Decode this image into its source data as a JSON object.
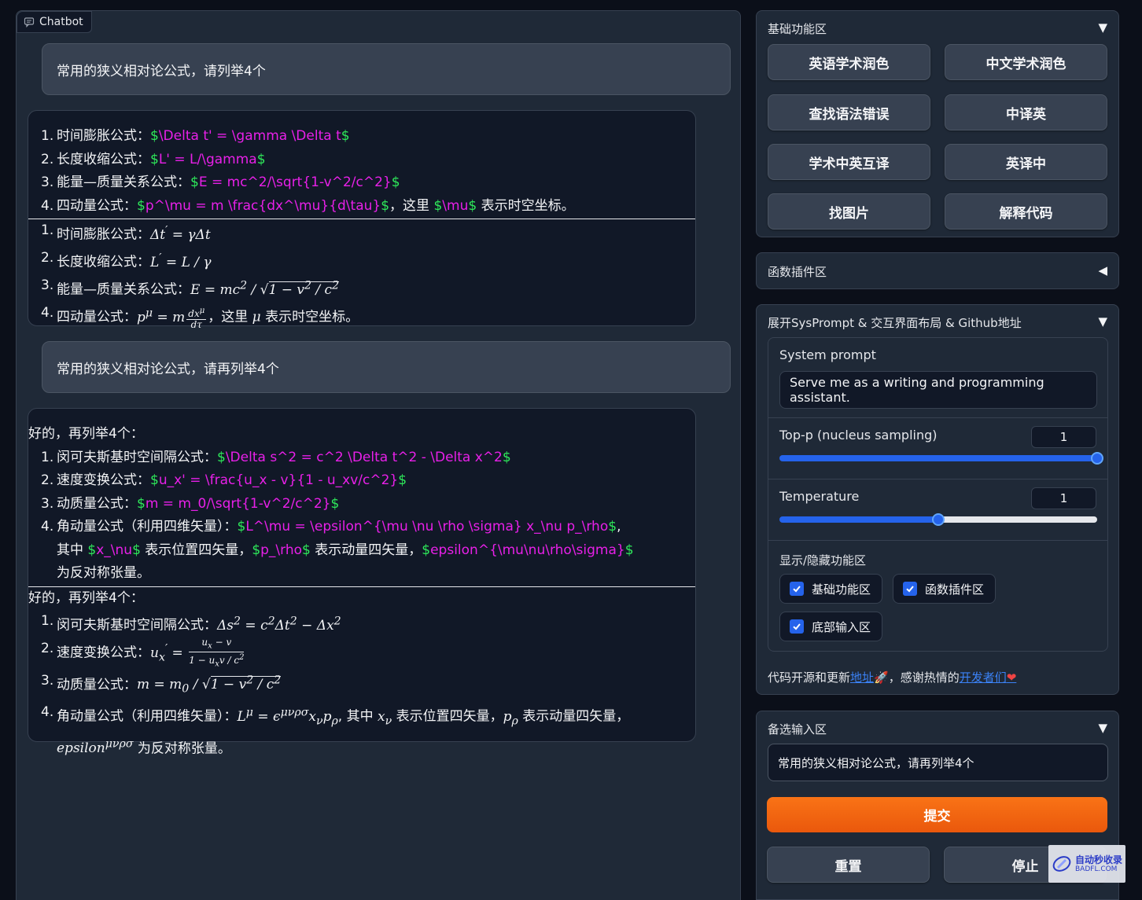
{
  "chatbot": {
    "label": "Chatbot",
    "user_messages": [
      "常用的狭义相对论公式，请列举4个",
      "常用的狭义相对论公式，请再列举4个"
    ],
    "bot1": {
      "raw": [
        {
          "n": "1",
          "label": "时间膨胀公式：",
          "d1": "$",
          "m1": "\\Delta t' = \\gamma \\Delta t",
          "d2": "$"
        },
        {
          "n": "2",
          "label": "长度收缩公式：",
          "d1": "$",
          "m1": "L' = L/\\gamma",
          "d2": "$"
        },
        {
          "n": "3",
          "label": "能量—质量关系公式：",
          "d1": "$",
          "m1": "E = mc^2/\\sqrt{1-v^2/c^2}",
          "d2": "$"
        },
        {
          "n": "4",
          "label": "四动量公式：",
          "d1": "$",
          "m1": "p^\\mu = m \\frac{dx^\\mu}{d\\tau}",
          "d2": "$",
          "t2": "，这里 ",
          "d3": "$",
          "m2": "\\mu",
          "d4": "$",
          "t3": " 表示时空坐标。"
        }
      ],
      "rendered": [
        {
          "n": "1",
          "label": "时间膨胀公式："
        },
        {
          "n": "2",
          "label": "长度收缩公式："
        },
        {
          "n": "3",
          "label": "能量—质量关系公式："
        },
        {
          "n": "4",
          "label": "四动量公式：",
          "t2": "，这里 ",
          "t3": " 表示时空坐标。"
        }
      ]
    },
    "bot2": {
      "intro": "好的，再列举4个：",
      "raw": [
        {
          "n": "1",
          "label": "闵可夫斯基时空间隔公式：",
          "d1": "$",
          "m1": "\\Delta s^2 = c^2 \\Delta t^2 - \\Delta x^2",
          "d2": "$"
        },
        {
          "n": "2",
          "label": "速度变换公式：",
          "d1": "$",
          "m1": "u_x' = \\frac{u_x - v}{1 - u_xv/c^2}",
          "d2": "$"
        },
        {
          "n": "3",
          "label": "动质量公式：",
          "d1": "$",
          "m1": "m = m_0/\\sqrt{1-v^2/c^2}",
          "d2": "$"
        },
        {
          "n": "4",
          "label": "角动量公式（利用四维矢量）：",
          "d1": "$",
          "m1": "L^\\mu = \\epsilon^{\\mu \\nu \\rho \\sigma} x_\\nu p_\\rho",
          "d2": "$",
          "t2": ",",
          "t2b": "其中 ",
          "d3": "$",
          "m2": "x_\\nu",
          "d4": "$",
          "t3": " 表示位置四矢量，",
          "d5": "$",
          "m3": "p_\\rho",
          "d6": "$",
          "t4": " 表示动量四矢量，",
          "d7": "$",
          "m4": "epsilon^{\\mu\\nu\\rho\\sigma}",
          "d8": "$",
          "t5": "为反对称张量。"
        }
      ],
      "rendered": [
        {
          "n": "1",
          "label": "闵可夫斯基时空间隔公式："
        },
        {
          "n": "2",
          "label": "速度变换公式："
        },
        {
          "n": "3",
          "label": "动质量公式："
        },
        {
          "n": "4",
          "label": "角动量公式（利用四维矢量）：",
          "t2": ", 其中 ",
          "t3": " 表示位置四矢量，",
          "t4": " 表示动量四矢量，",
          "t5": " 为反对称张量。"
        }
      ]
    }
  },
  "basic": {
    "title": "基础功能区",
    "buttons": [
      "英语学术润色",
      "中文学术润色",
      "查找语法错误",
      "中译英",
      "学术中英互译",
      "英译中",
      "找图片",
      "解释代码"
    ]
  },
  "plugins": {
    "title": "函数插件区"
  },
  "sysprompt": {
    "title": "展开SysPrompt & 交互界面布局 & Github地址",
    "system_prompt_label": "System prompt",
    "system_prompt_value": "Serve me as a writing and programming assistant.",
    "top_p_label": "Top-p (nucleus sampling)",
    "top_p_value": "1",
    "top_p_fraction": 1.0,
    "temperature_label": "Temperature",
    "temperature_value": "1",
    "temperature_fraction": 0.5,
    "toggle_label": "显示/隐藏功能区",
    "checkboxes": [
      "基础功能区",
      "函数插件区",
      "底部输入区"
    ],
    "footer_prefix": "代码开源和更新",
    "footer_link1": "地址",
    "footer_mid": "，感谢热情的",
    "footer_link2": "开发者们"
  },
  "input": {
    "title": "备选输入区",
    "value": "常用的狭义相对论公式，请再列举4个",
    "submit_label": "提交",
    "reset_label": "重置",
    "stop_label": "停止"
  },
  "watermark": {
    "line1": "自动秒收录",
    "line2": "BADFL.COM"
  },
  "colors": {
    "accent": "#f97316",
    "link": "#3b82f6",
    "math_magenta": "#e820e8",
    "math_delim_green": "#2ee85a",
    "panel": "#1f2937",
    "background": "#0b0f19"
  }
}
